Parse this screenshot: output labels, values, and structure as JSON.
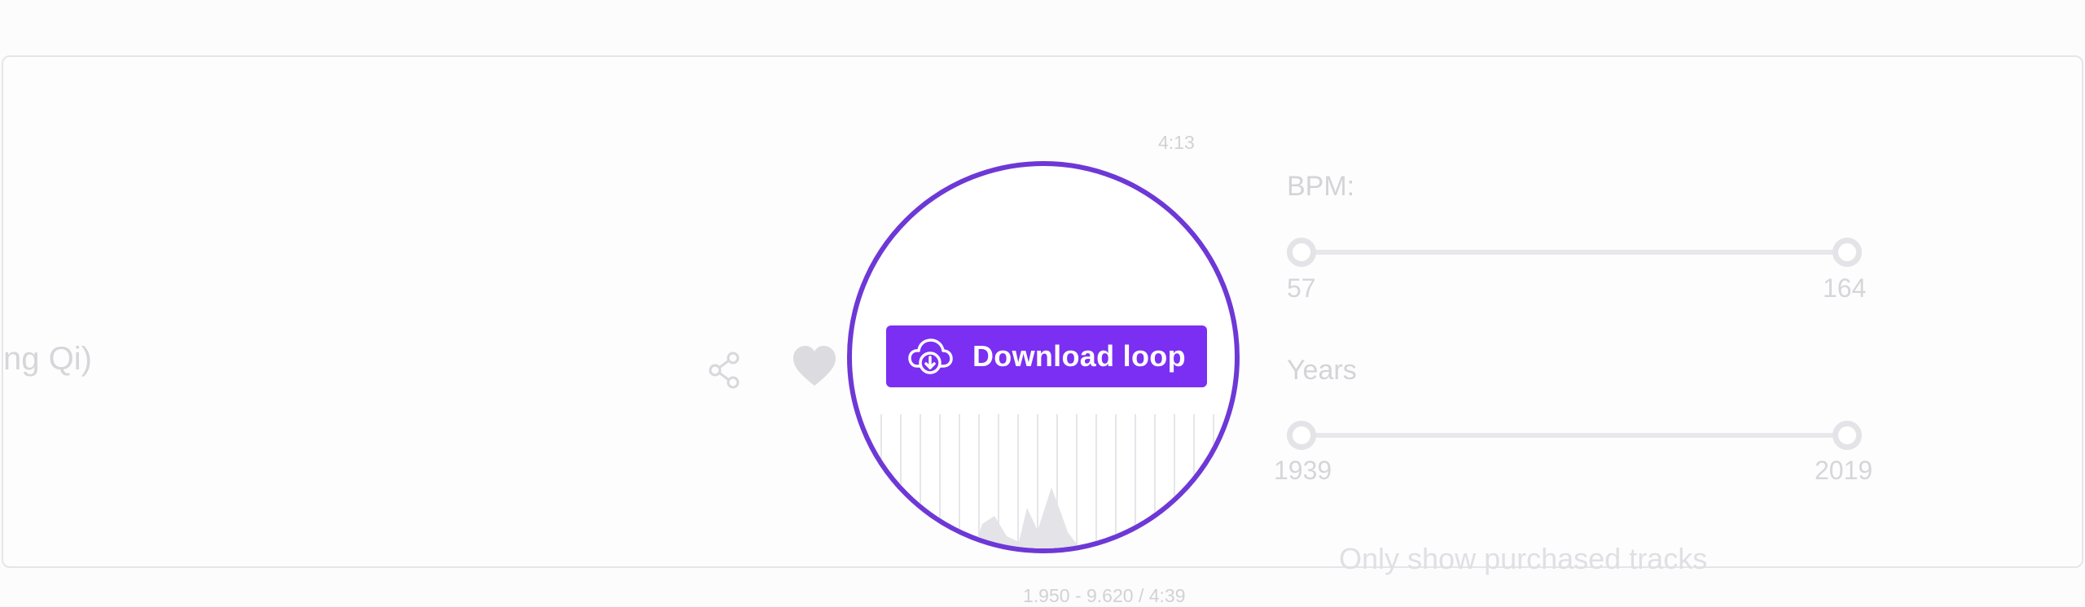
{
  "track": {
    "title_fragment": "ng Qi)"
  },
  "player": {
    "duration_top": "4:13",
    "loop_range_label": "1.950 - 9.620 / 4:39",
    "download_button_label": "Download loop",
    "accent_color": "#7b2ff2",
    "highlight_ring_color": "#6d38d6"
  },
  "filters": {
    "bpm": {
      "label": "BPM:",
      "min": "57",
      "max": "164"
    },
    "years": {
      "label": "Years",
      "min": "1939",
      "max": "2019"
    },
    "purchased_only_label": "Only show purchased tracks"
  },
  "icons": {
    "share": "share-icon",
    "heart": "heart-icon",
    "download": "cloud-download-icon"
  }
}
